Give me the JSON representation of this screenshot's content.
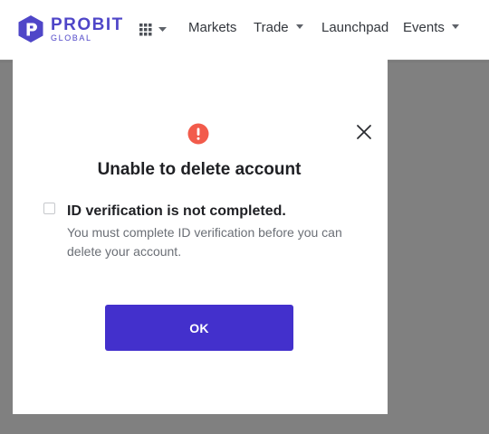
{
  "header": {
    "logo": {
      "name": "PROBIT",
      "sub": "GLOBAL",
      "color": "#4f46c8"
    },
    "apps_menu_icon": "grid-icon",
    "nav": [
      {
        "label": "Markets",
        "has_dropdown": false
      },
      {
        "label": "Trade",
        "has_dropdown": true
      },
      {
        "label": "Launchpad",
        "has_dropdown": false
      },
      {
        "label": "Events",
        "has_dropdown": true
      }
    ]
  },
  "dialog": {
    "icon": "alert-icon",
    "icon_color": "#f25b4b",
    "title": "Unable to delete account",
    "close_icon": "close-icon",
    "item": {
      "checked": false,
      "heading": "ID verification is not completed.",
      "description": "You must complete ID verification before you can delete your account."
    },
    "ok_label": "OK",
    "ok_color": "#4330cc"
  }
}
